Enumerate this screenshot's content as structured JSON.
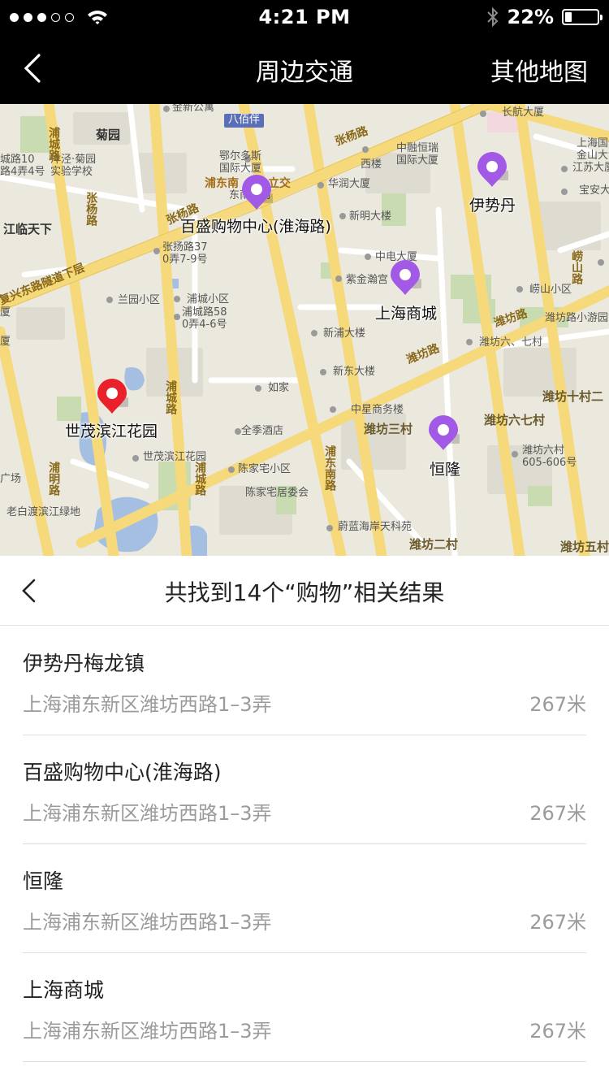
{
  "status_bar": {
    "time": "4:21 PM",
    "battery_percent": "22%",
    "battery_level": 0.22,
    "signal_dots_filled": 3,
    "signal_dots_total": 5,
    "icons": [
      "signal-dots",
      "wifi-icon",
      "bluetooth-icon",
      "battery-icon"
    ]
  },
  "nav": {
    "back_icon": "chevron-left-icon",
    "title": "周边交通",
    "right_button": "其他地图"
  },
  "map": {
    "pins": [
      {
        "label": "百盛购物中心(淮海路)",
        "color": "#a259e6",
        "type": "shopping"
      },
      {
        "label": "伊势丹",
        "color": "#a259e6",
        "type": "shopping"
      },
      {
        "label": "上海商城",
        "color": "#a259e6",
        "type": "shopping"
      },
      {
        "label": "恒隆",
        "color": "#a259e6",
        "type": "shopping"
      },
      {
        "label": "世茂滨江花园",
        "color": "#e8212b",
        "type": "current-location"
      }
    ],
    "labels": {
      "juyuan": "菊园",
      "jinxin": "金新公寓",
      "babaiban": "八佰伴",
      "zhangyang_road_top": "张杨路",
      "erdos": "鄂尔多斯\n国际大厦",
      "zhongrong": "中融恒瑞\n国际大厦",
      "xilou": "西楼",
      "changhang": "长航大厦",
      "shanghai_intl": "上海国信\n金山大酒",
      "jiangsu": "江苏大厦",
      "baoan": "宝安大厦",
      "chengluo": "城路10\n路4弄4号",
      "yangjing": "洋泾·菊园\n实验学校",
      "pudong_nan": "浦东南",
      "dongfang": "东南新村",
      "huarun": "华润大厦",
      "xinming": "新明大楼",
      "lijiao": "立交",
      "pucheng_road": "浦城路",
      "jianglin": "江临天下",
      "zhangyang_road": "张杨路",
      "fuxing_tunnel": "复兴东路隧道下层",
      "zhangyang37": "张扬路37\n0弄7-9号",
      "zhongdian": "中电大厦",
      "zijin": "紫金瀚宫",
      "lanyuan": "兰园小区",
      "pucheng_xq": "浦城小区",
      "pucheng58": "浦城路58\n0弄4-6号",
      "xinpu": "新浦大楼",
      "xindong": "新东大楼",
      "weifang_road": "潍坊路",
      "weifang67": "潍坊六、七村",
      "qiaoshan_road": "崂山路",
      "laoshan_xq": "崂山小区",
      "weifang_park": "潍坊路小游园",
      "pucheng_road2": "浦城路",
      "rujia": "如家",
      "zhongxing": "中星商务楼",
      "weifang3": "潍坊三村",
      "weifang_67b": "潍坊六七村",
      "weifang10": "潍坊十村二",
      "weifang6": "潍坊六村\n605-606号",
      "quanji": "全季酒店",
      "shimao_xq": "世茂滨江花园",
      "chenjiazhai": "陈家宅小区",
      "chenjiazhai_jwh": "陈家宅居委会",
      "pudong_south": "浦东南路",
      "weilan": "蔚蓝海岸天科苑",
      "weifang2": "潍坊二村",
      "weifang5": "潍坊五村",
      "guangchang": "广场",
      "laobaidu": "老白渡滨江绿地",
      "puming_road": "浦明路",
      "xia": "厦",
      "xia2": "厦"
    }
  },
  "results": {
    "back_icon": "chevron-left-icon",
    "summary": "共找到14个“购物”相关结果",
    "items": [
      {
        "name": "伊势丹梅龙镇",
        "address": "上海浦东新区潍坊西路1–3弄",
        "distance": "267米"
      },
      {
        "name": "百盛购物中心(淮海路)",
        "address": "上海浦东新区潍坊西路1–3弄",
        "distance": "267米"
      },
      {
        "name": "恒隆",
        "address": "上海浦东新区潍坊西路1–3弄",
        "distance": "267米"
      },
      {
        "name": "上海商城",
        "address": "上海浦东新区潍坊西路1–3弄",
        "distance": "267米"
      }
    ]
  }
}
